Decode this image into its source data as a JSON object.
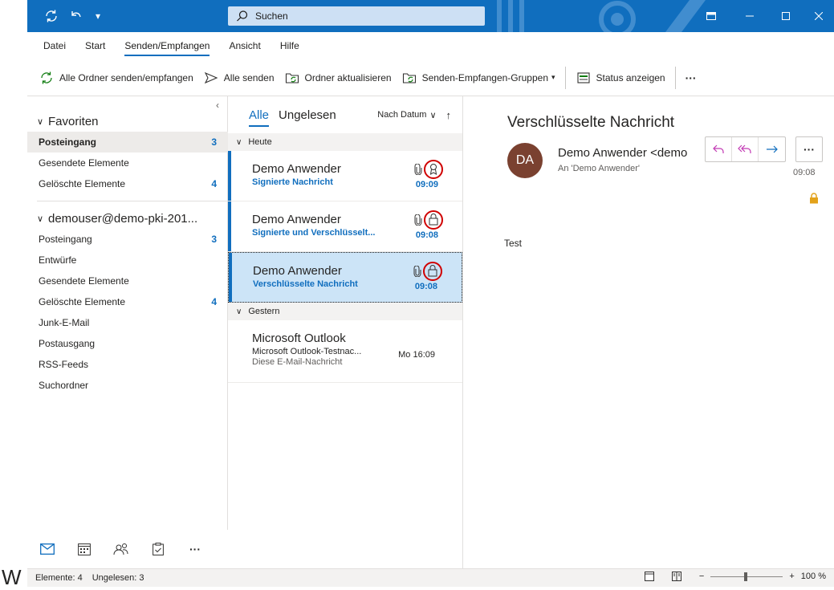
{
  "outside_text": "W",
  "titlebar": {
    "search_label": "Suchen",
    "accent_color": "#106ebe"
  },
  "menu": {
    "items": [
      "Datei",
      "Start",
      "Senden/Empfangen",
      "Ansicht",
      "Hilfe"
    ],
    "active": "Senden/Empfangen"
  },
  "ribbon": {
    "send_receive_all": "Alle Ordner senden/empfangen",
    "send_all": "Alle senden",
    "update_folder": "Ordner aktualisieren",
    "send_receive_groups": "Senden-Empfangen-Gruppen",
    "show_status": "Status anzeigen",
    "more": "···"
  },
  "folders": {
    "favorites_header": "Favoriten",
    "favorites": [
      {
        "label": "Posteingang",
        "count": "3"
      },
      {
        "label": "Gesendete Elemente",
        "count": ""
      },
      {
        "label": "Gelöschte Elemente",
        "count": "4"
      }
    ],
    "account_header": "demouser@demo-pki-201...",
    "account": [
      {
        "label": "Posteingang",
        "count": "3"
      },
      {
        "label": "Entwürfe",
        "count": ""
      },
      {
        "label": "Gesendete Elemente",
        "count": ""
      },
      {
        "label": "Gelöschte Elemente",
        "count": "4"
      },
      {
        "label": "Junk-E-Mail",
        "count": ""
      },
      {
        "label": "Postausgang",
        "count": ""
      },
      {
        "label": "RSS-Feeds",
        "count": ""
      },
      {
        "label": "Suchordner",
        "count": ""
      }
    ]
  },
  "list": {
    "tab_all": "Alle",
    "tab_unread": "Ungelesen",
    "sort": "Nach Datum",
    "group_today": "Heute",
    "group_yesterday": "Gestern",
    "messages": [
      {
        "from": "Demo Anwender",
        "subject": "Signierte Nachricht",
        "time": "09:09"
      },
      {
        "from": "Demo Anwender",
        "subject": "Signierte und Verschlüsselt...",
        "time": "09:08"
      },
      {
        "from": "Demo Anwender",
        "subject": "Verschlüsselte Nachricht",
        "time": "09:08"
      }
    ],
    "yesterday_msg": {
      "from": "Microsoft Outlook",
      "subject": "Microsoft Outlook-Testnac...",
      "preview": "Diese E-Mail-Nachricht",
      "time": "Mo 16:09"
    }
  },
  "reading": {
    "title": "Verschlüsselte Nachricht",
    "avatar": "DA",
    "sender": "Demo Anwender <demo",
    "to": "An  'Demo Anwender'",
    "time": "09:08",
    "body": "Test",
    "more": "···"
  },
  "status": {
    "items": "Elemente: 4",
    "unread": "Ungelesen: 3",
    "zoom": "100 %",
    "zoom_level_percent": 100
  }
}
